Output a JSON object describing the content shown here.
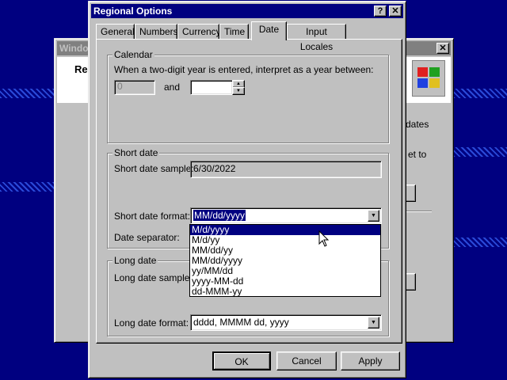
{
  "background_window": {
    "title": "Windov",
    "heading": "Re",
    "text_dates": "dates",
    "text_set_to": "et to"
  },
  "dialog": {
    "title": "Regional Options",
    "help_button": "?",
    "close_button": "✕",
    "tabs": [
      {
        "label": "General",
        "active": false
      },
      {
        "label": "Numbers",
        "active": false
      },
      {
        "label": "Currency",
        "active": false
      },
      {
        "label": "Time",
        "active": false
      },
      {
        "label": "Date",
        "active": true
      },
      {
        "label": "Input Locales",
        "active": false
      }
    ],
    "calendar": {
      "title": "Calendar",
      "description": "When a two-digit year is entered, interpret as a year between:",
      "from_value": "0",
      "and_label": "and",
      "to_value": ""
    },
    "short_date": {
      "title": "Short date",
      "sample_label": "Short date sample:",
      "sample_value": "6/30/2022",
      "format_label": "Short date format:",
      "format_value": "MM/dd/yyyy",
      "separator_label": "Date separator:",
      "options": [
        "M/d/yyyy",
        "M/d/yy",
        "MM/dd/yy",
        "MM/dd/yyyy",
        "yy/MM/dd",
        "yyyy-MM-dd",
        "dd-MMM-yy"
      ],
      "highlighted_option": "M/d/yyyy"
    },
    "long_date": {
      "title": "Long date",
      "sample_label": "Long date sample:",
      "format_label": "Long date format:",
      "format_value": "dddd, MMMM dd, yyyy"
    },
    "buttons": {
      "ok": "OK",
      "cancel": "Cancel",
      "apply": "Apply"
    }
  },
  "colors": {
    "desktop": "#000080",
    "active_title": "#000080",
    "inactive_title": "#808080",
    "face": "#c0c0c0"
  }
}
